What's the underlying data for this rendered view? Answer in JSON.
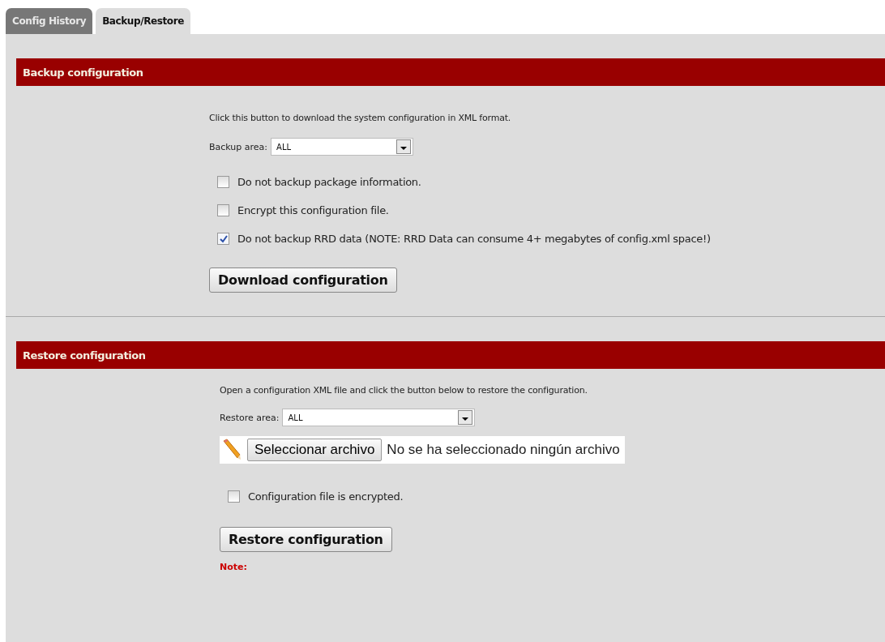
{
  "tabs": [
    {
      "label": "Config History",
      "selected": false
    },
    {
      "label": "Backup/Restore",
      "selected": true
    }
  ],
  "backup": {
    "title": "Backup configuration",
    "description": "Click this button to download the system configuration in XML format.",
    "area_label": "Backup area:",
    "area_value": "ALL",
    "options": [
      {
        "label": "Do not backup package information.",
        "checked": false
      },
      {
        "label": "Encrypt this configuration file.",
        "checked": false
      },
      {
        "label": "Do not backup RRD data (NOTE: RRD Data can consume 4+ megabytes of config.xml space!)",
        "checked": true
      }
    ],
    "button": "Download configuration"
  },
  "restore": {
    "title": "Restore configuration",
    "description": "Open a configuration XML file and click the button below to restore the configuration.",
    "area_label": "Restore area:",
    "area_value": "ALL",
    "file_button": "Seleccionar archivo",
    "file_status": "No se ha seleccionado ningún archivo",
    "options": [
      {
        "label": "Configuration file is encrypted.",
        "checked": false
      }
    ],
    "button": "Restore configuration",
    "note": "Note:"
  }
}
